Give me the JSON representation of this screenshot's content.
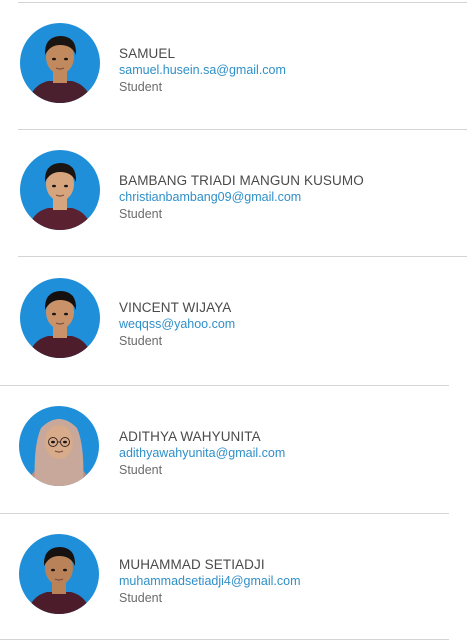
{
  "members": [
    {
      "name": "SAMUEL",
      "email": "samuel.husein.sa@gmail.com",
      "role": "Student",
      "avatar": {
        "bg": "#1e8fd8",
        "skin": "#c08a5e",
        "hair": "#1a1412",
        "shirt": "#4a1f2e",
        "hijab": false,
        "glasses": false
      }
    },
    {
      "name": "BAMBANG TRIADI MANGUN KUSUMO",
      "email": "christianbambang09@gmail.com",
      "role": "Student",
      "avatar": {
        "bg": "#1e8fd8",
        "skin": "#d6a57e",
        "hair": "#1a1412",
        "shirt": "#5a2230",
        "hijab": false,
        "glasses": false
      }
    },
    {
      "name": "VINCENT WIJAYA",
      "email": "weqqss@yahoo.com",
      "role": "Student",
      "avatar": {
        "bg": "#1e8fd8",
        "skin": "#c99268",
        "hair": "#141010",
        "shirt": "#4d1d2b",
        "hijab": false,
        "glasses": false
      }
    },
    {
      "name": "ADITHYA WAHYUNITA",
      "email": "adithyawahyunita@gmail.com",
      "role": "Student",
      "avatar": {
        "bg": "#1e8fd8",
        "skin": "#d8ab8a",
        "hair": "#c8a89a",
        "shirt": "#b88e80",
        "hijab": true,
        "glasses": true
      }
    },
    {
      "name": "MUHAMMAD SETIADJI",
      "email": "muhammadsetiadji4@gmail.com",
      "role": "Student",
      "avatar": {
        "bg": "#1e8fd8",
        "skin": "#b98258",
        "hair": "#161212",
        "shirt": "#4d1c2b",
        "hijab": false,
        "glasses": false
      }
    }
  ]
}
